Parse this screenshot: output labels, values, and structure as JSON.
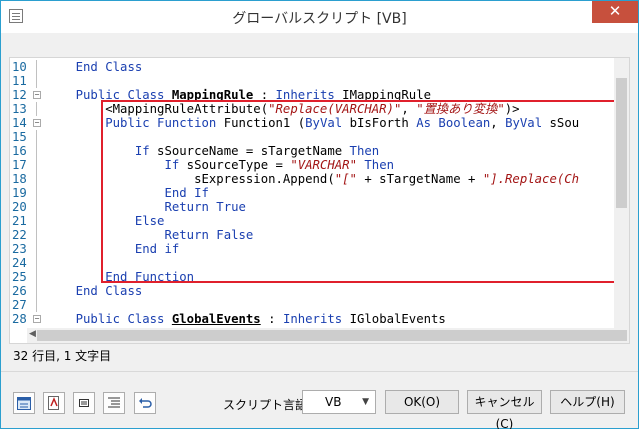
{
  "window": {
    "title": "グローバルスクリプト [VB]",
    "close_glyph": "✕"
  },
  "editor": {
    "lines": [
      {
        "num": "10",
        "segments": [
          {
            "t": "    ",
            "c": ""
          },
          {
            "t": "End Class",
            "c": "kw"
          }
        ]
      },
      {
        "num": "11",
        "segments": []
      },
      {
        "num": "12",
        "fold": true,
        "segments": [
          {
            "t": "    ",
            "c": ""
          },
          {
            "t": "Public Class ",
            "c": "kw"
          },
          {
            "t": "MappingRule",
            "c": "bold"
          },
          {
            "t": " : ",
            "c": ""
          },
          {
            "t": "Inherits",
            "c": "kw"
          },
          {
            "t": " IMappingRule",
            "c": ""
          }
        ]
      },
      {
        "num": "13",
        "segments": [
          {
            "t": "        <MappingRuleAttribute(",
            "c": ""
          },
          {
            "t": "\"Replace(VARCHAR)\"",
            "c": "str"
          },
          {
            "t": ", ",
            "c": ""
          },
          {
            "t": "\"置換あり変換\"",
            "c": "str"
          },
          {
            "t": ")>",
            "c": ""
          }
        ]
      },
      {
        "num": "14",
        "fold": true,
        "segments": [
          {
            "t": "        ",
            "c": ""
          },
          {
            "t": "Public Function",
            "c": "kw"
          },
          {
            "t": " Function1 (",
            "c": ""
          },
          {
            "t": "ByVal",
            "c": "kw"
          },
          {
            "t": " bIsForth ",
            "c": ""
          },
          {
            "t": "As Boolean",
            "c": "kw"
          },
          {
            "t": ", ",
            "c": ""
          },
          {
            "t": "ByVal",
            "c": "kw"
          },
          {
            "t": " sSou",
            "c": ""
          }
        ]
      },
      {
        "num": "15",
        "segments": []
      },
      {
        "num": "16",
        "segments": [
          {
            "t": "            ",
            "c": ""
          },
          {
            "t": "If",
            "c": "kw"
          },
          {
            "t": " sSourceName = sTargetName ",
            "c": ""
          },
          {
            "t": "Then",
            "c": "kw"
          }
        ]
      },
      {
        "num": "17",
        "segments": [
          {
            "t": "                ",
            "c": ""
          },
          {
            "t": "If",
            "c": "kw"
          },
          {
            "t": " sSourceType = ",
            "c": ""
          },
          {
            "t": "\"VARCHAR\"",
            "c": "str"
          },
          {
            "t": " ",
            "c": ""
          },
          {
            "t": "Then",
            "c": "kw"
          }
        ]
      },
      {
        "num": "18",
        "segments": [
          {
            "t": "                    sExpression.Append(",
            "c": ""
          },
          {
            "t": "\"[\"",
            "c": "str"
          },
          {
            "t": " + sTargetName + ",
            "c": ""
          },
          {
            "t": "\"].Replace(Ch",
            "c": "str"
          }
        ]
      },
      {
        "num": "19",
        "segments": [
          {
            "t": "                ",
            "c": ""
          },
          {
            "t": "End If",
            "c": "kw"
          }
        ]
      },
      {
        "num": "20",
        "segments": [
          {
            "t": "                ",
            "c": ""
          },
          {
            "t": "Return True",
            "c": "kw"
          }
        ]
      },
      {
        "num": "21",
        "segments": [
          {
            "t": "            ",
            "c": ""
          },
          {
            "t": "Else",
            "c": "kw"
          }
        ]
      },
      {
        "num": "22",
        "segments": [
          {
            "t": "                ",
            "c": ""
          },
          {
            "t": "Return False",
            "c": "kw"
          }
        ]
      },
      {
        "num": "23",
        "segments": [
          {
            "t": "            ",
            "c": ""
          },
          {
            "t": "End if",
            "c": "kw"
          }
        ]
      },
      {
        "num": "24",
        "segments": []
      },
      {
        "num": "25",
        "segments": [
          {
            "t": "        ",
            "c": ""
          },
          {
            "t": "End Function",
            "c": "kw"
          }
        ]
      },
      {
        "num": "26",
        "segments": [
          {
            "t": "    ",
            "c": ""
          },
          {
            "t": "End Class",
            "c": "kw"
          }
        ]
      },
      {
        "num": "27",
        "segments": []
      },
      {
        "num": "28",
        "fold": true,
        "segments": [
          {
            "t": "    ",
            "c": ""
          },
          {
            "t": "Public Class ",
            "c": "kw"
          },
          {
            "t": "GlobalEvents",
            "c": "bold"
          },
          {
            "t": " : ",
            "c": ""
          },
          {
            "t": "Inherits",
            "c": "kw"
          },
          {
            "t": " IGlobalEvents",
            "c": ""
          }
        ]
      }
    ]
  },
  "status": {
    "position": "32 行目, 1 文字目"
  },
  "toolbar": {
    "tools": [
      "calendar-icon",
      "format-icon",
      "snippet-icon",
      "list-icon",
      "undo-icon"
    ],
    "lang_label": "スクリプト言語:",
    "lang_value": "VB",
    "ok_label": "OK(O)",
    "cancel_label": "キャンセル(C)",
    "help_label": "ヘルプ(H)"
  },
  "colors": {
    "keyword": "#1a3fb0",
    "string": "#a31515",
    "highlight": "#e0202c",
    "close": "#c7503d"
  }
}
